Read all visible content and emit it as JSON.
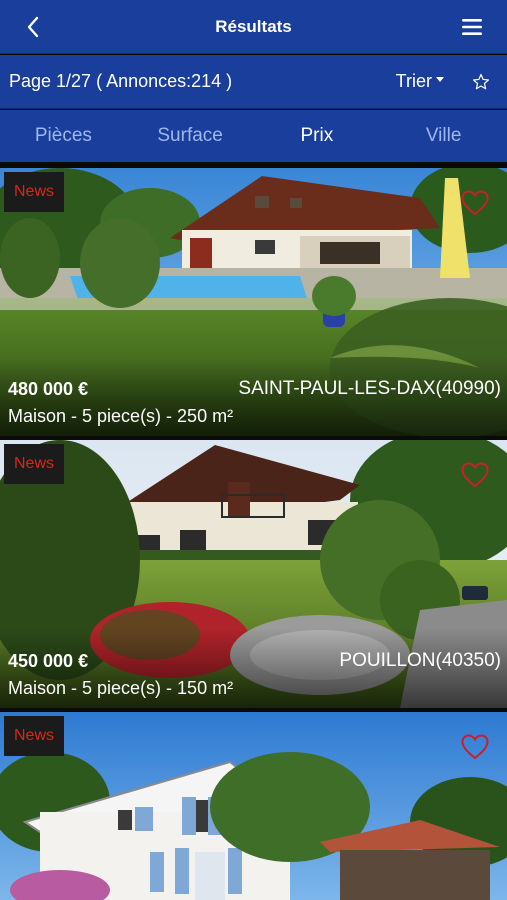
{
  "header": {
    "title": "Résultats"
  },
  "pagination": {
    "info": "Page 1/27 ( Annonces:214 )",
    "sort_label": "Trier"
  },
  "filters": [
    {
      "label": "Pièces",
      "active": false
    },
    {
      "label": "Surface",
      "active": false
    },
    {
      "label": "Prix",
      "active": true
    },
    {
      "label": "Ville",
      "active": false
    }
  ],
  "listings": [
    {
      "badge": "News",
      "price": "480 000 €",
      "city": "SAINT-PAUL-LES-DAX(40990)",
      "description": "Maison - 5 piece(s) - 250 m²"
    },
    {
      "badge": "News",
      "price": "450 000 €",
      "city": "POUILLON(40350)",
      "description": "Maison - 5 piece(s) - 150 m²"
    },
    {
      "badge": "News"
    }
  ],
  "colors": {
    "header_bg": "#1a3e9c",
    "badge_text": "#e0231d",
    "heart": "#c8202a"
  },
  "icons": [
    "back-arrow-icon",
    "hamburger-menu-icon",
    "caret-down-icon",
    "star-outline-icon",
    "heart-outline-icon"
  ]
}
